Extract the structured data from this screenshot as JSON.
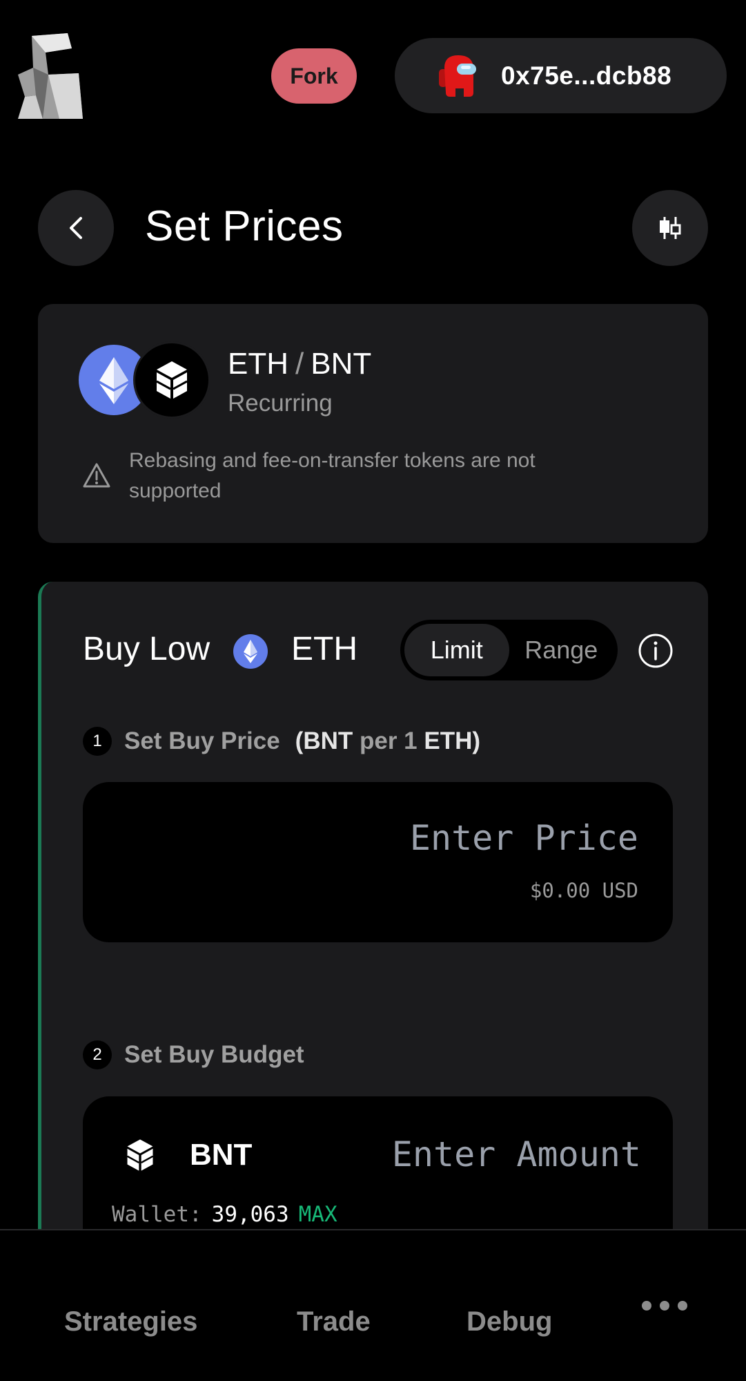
{
  "header": {
    "fork_label": "Fork",
    "wallet_address": "0x75e...dcb88"
  },
  "title_row": {
    "title": "Set Prices"
  },
  "pair": {
    "base": "ETH",
    "quote": "BNT",
    "separator": "/",
    "type": "Recurring",
    "warning": "Rebasing and fee-on-transfer tokens are not supported"
  },
  "buy": {
    "title": "Buy Low",
    "token": "ETH",
    "toggle": {
      "limit": "Limit",
      "range": "Range",
      "selected": "Limit"
    },
    "step1": {
      "num": "1",
      "label": "Set Buy Price",
      "paren_open": "(",
      "quote": "BNT",
      "per": " per 1 ",
      "base": "ETH",
      "paren_close": ")"
    },
    "price_placeholder": "Enter Price",
    "price_usd": "$0.00 USD",
    "step2": {
      "num": "2",
      "label": "Set Buy Budget"
    },
    "budget_token": "BNT",
    "amount_placeholder": "Enter Amount",
    "wallet_label": "Wallet:",
    "wallet_balance": "39,063",
    "max_label": "MAX"
  },
  "nav": {
    "strategies": "Strategies",
    "trade": "Trade",
    "debug": "Debug"
  },
  "colors": {
    "fork_bg": "#d8636e",
    "eth_blue": "#627eea",
    "buy_accent": "#1b7a54",
    "max_green": "#17b978"
  }
}
